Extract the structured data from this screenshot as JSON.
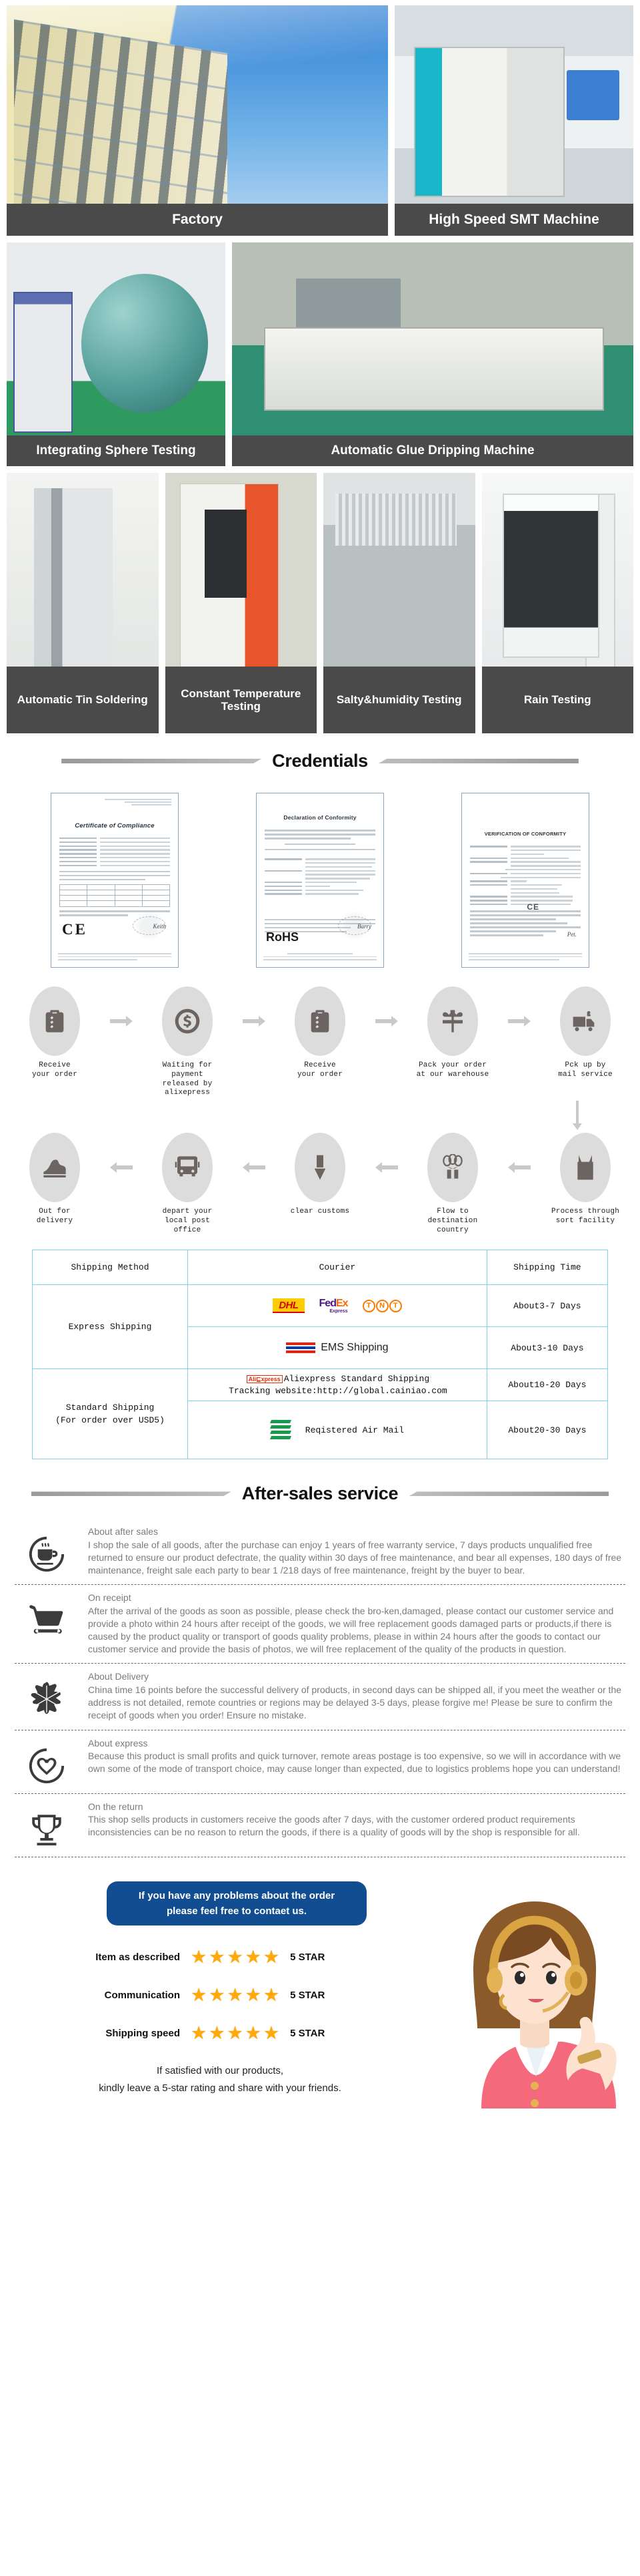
{
  "facility": {
    "row1": [
      {
        "caption": "Factory",
        "photo": "factory-building"
      },
      {
        "caption": "High Speed SMT Machine",
        "photo": "smt-machine"
      }
    ],
    "row2": [
      {
        "caption": "Integrating Sphere Testing",
        "photo": "integrating-sphere"
      },
      {
        "caption": "Automatic Glue Dripping Machine",
        "photo": "glue-dripping-machine"
      }
    ],
    "row3": [
      {
        "caption": "Automatic Tin Soldering",
        "photo": "tin-soldering-machine"
      },
      {
        "caption": "Constant Temperature Testing",
        "photo": "temperature-chamber"
      },
      {
        "caption": "Salty&humidity Testing",
        "photo": "salt-spray-chamber"
      },
      {
        "caption": "Rain Testing",
        "photo": "rain-test-chamber"
      }
    ]
  },
  "credentials": {
    "heading": "Credentials",
    "certificates": [
      {
        "title": "Certificate of Compliance",
        "mark": "CE",
        "style": "italic"
      },
      {
        "title": "Declaration of Conformity",
        "mark": "RoHS",
        "style": "plain"
      },
      {
        "title": "VERIFICATION OF CONFORMITY",
        "mark": "CE",
        "style": "plain"
      }
    ]
  },
  "order_flow": {
    "top_steps": [
      {
        "icon": "clipboard-icon",
        "line1": "Receive",
        "line2": "your order"
      },
      {
        "icon": "dollar-coin-icon",
        "line1": "Waiting for payment",
        "line2": "released by alixepress"
      },
      {
        "icon": "clipboard-icon",
        "line1": "Receive",
        "line2": "your order"
      },
      {
        "icon": "gift-box-icon",
        "line1": "Pack your order",
        "line2": "at our warehouse"
      },
      {
        "icon": "delivery-truck-icon",
        "line1": "Pck up by",
        "line2": "mail service"
      }
    ],
    "bottom_steps": [
      {
        "icon": "high-heel-shoe-icon",
        "line1": "Out for",
        "line2": "delivery"
      },
      {
        "icon": "bus-icon",
        "line1": "depart your",
        "line2": "local post office"
      },
      {
        "icon": "customs-stamp-icon",
        "line1": "clear customs",
        "line2": ""
      },
      {
        "icon": "balloon-gift-icon",
        "line1": "Flow to",
        "line2": "destination country"
      },
      {
        "icon": "shopping-bag-icon",
        "line1": "Process through",
        "line2": "sort facility"
      }
    ]
  },
  "shipping_table": {
    "headers": [
      "Shipping Method",
      "Courier",
      "Shipping Time"
    ],
    "rows": [
      {
        "method": "Express Shipping",
        "method_note": "",
        "couriers": [
          {
            "type": "logos",
            "items": [
              "DHL",
              "FedEx Express",
              "TNT"
            ],
            "time": "About3-7 Days"
          },
          {
            "type": "ems",
            "label": "EMS Shipping",
            "time": "About3-10 Days"
          }
        ]
      },
      {
        "method": "Standard Shipping",
        "method_note": "(For order over USD5)",
        "couriers": [
          {
            "type": "ali",
            "label": "Aliexpress Standard Shipping",
            "badge": "AliExpress",
            "tracking": "Tracking website:http://global.cainiao.com",
            "time": "About10-20 Days"
          },
          {
            "type": "airmail",
            "label": "Reqistered Air Mail",
            "time": "About20-30 Days"
          }
        ]
      }
    ]
  },
  "after_sales": {
    "heading": "After-sales service",
    "items": [
      {
        "icon": "coffee-cup-icon",
        "title": "About after sales",
        "text": " I shop the sale of all goods, after the purchase can enjoy 1 years of free warranty service, 7 days products unqualified free returned to ensure our product defectrate, the quality within 30 days of free maintenance, and bear all expenses, 180 days of free maintenance, freight sale each party to bear 1 /218 days of free maintenance, freight by the buyer to bear."
      },
      {
        "icon": "shopping-cart-icon",
        "title": "On receipt",
        "text": "After the arrival of the goods as soon as possible, please check the bro-ken,damaged, please contact our customer service and provide a photo within 24 hours after receipt of the goods, we will free replacement goods damaged parts or products,if there is caused by the product quality or transport of goods quality problems, please in within 24 hours after the goods to contact our customer service and provide the basis of photos, we will free replacement of the quality of the products in question."
      },
      {
        "icon": "star-badge-icon",
        "title": "About Delivery",
        "text": " China time 16 points before the successful delivery of products, in second days can be shipped all, if you meet the weather or the address is not detailed, remote countries or regions may be delayed 3-5 days, please forgive me! Please be sure to confirm the receipt of goods when you order! Ensure no mistake."
      },
      {
        "icon": "heart-icon",
        "title": "About express",
        "text": "Because this product is small profits and quick turnover, remote areas postage is too expensive, so we will in accordance with we own some of the mode of transport choice, may cause longer than expected, due to logistics problems hope you can understand!"
      },
      {
        "icon": "trophy-icon",
        "title": "On the return",
        "text": "This shop sells products in customers receive the goods after 7 days, with the customer ordered product requirements inconsistencies can be no reason to return the goods, if there is a quality of goods will by the shop is responsible for all."
      }
    ]
  },
  "contact": {
    "button_line1": "If you have any problems about the order",
    "button_line2": "please feel free to contaet us.",
    "button_color": "#124d91"
  },
  "ratings": {
    "star_color": "#ffa90a",
    "rows": [
      {
        "label": "Item as described",
        "stars": 5,
        "value": "5 STAR"
      },
      {
        "label": "Communication",
        "stars": 5,
        "value": "5 STAR"
      },
      {
        "label": "Shipping speed",
        "stars": 5,
        "value": "5 STAR"
      }
    ],
    "thanks_line1": "If satisfied with our products,",
    "thanks_line2": "kindly leave a 5-star rating and share with your friends."
  }
}
